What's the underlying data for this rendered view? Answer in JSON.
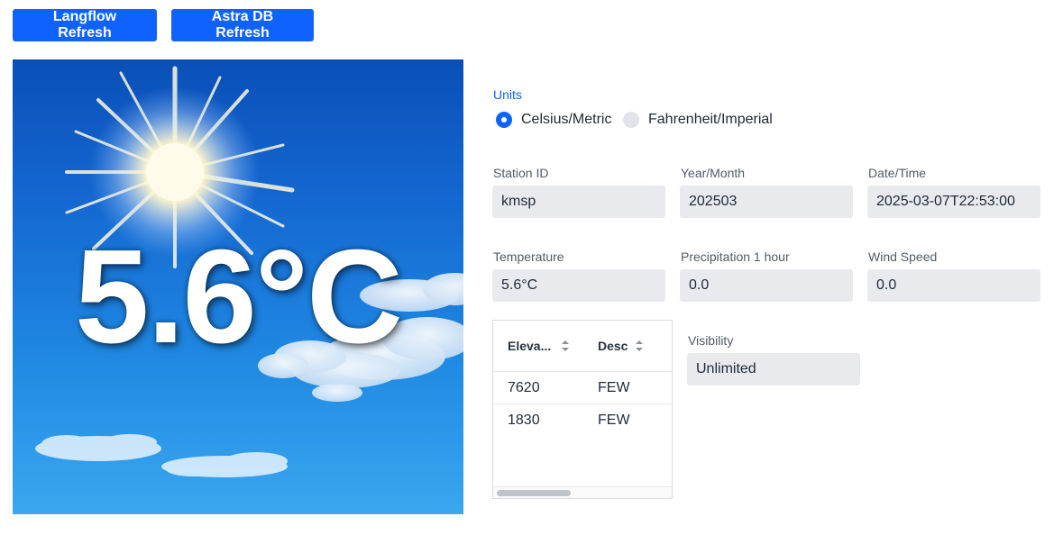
{
  "toolbar": {
    "langflow_refresh_label": "Langflow Refresh",
    "astra_refresh_label": "Astra DB Refresh"
  },
  "weather_image": {
    "temperature_text": "5.6°C",
    "condition_icon": "sunny-with-clouds"
  },
  "units": {
    "label": "Units",
    "options": [
      {
        "label": "Celsius/Metric",
        "selected": true
      },
      {
        "label": "Fahrenheit/Imperial",
        "selected": false
      }
    ]
  },
  "fields": {
    "station_id": {
      "label": "Station ID",
      "value": "kmsp"
    },
    "year_month": {
      "label": "Year/Month",
      "value": "202503"
    },
    "date_time": {
      "label": "Date/Time",
      "value": "2025-03-07T22:53:00"
    },
    "temperature": {
      "label": "Temperature",
      "value": "5.6°C"
    },
    "precipitation": {
      "label": "Precipitation 1 hour",
      "value": "0.0"
    },
    "wind_speed": {
      "label": "Wind Speed",
      "value": "0.0"
    },
    "visibility": {
      "label": "Visibility",
      "value": "Unlimited"
    }
  },
  "cloud_table": {
    "columns": [
      "Eleva...",
      "Desc"
    ],
    "rows": [
      [
        "7620",
        "FEW"
      ],
      [
        "1830",
        "FEW"
      ]
    ]
  },
  "colors": {
    "accent": "#0f62fe",
    "field_bg": "#e8eaed"
  }
}
